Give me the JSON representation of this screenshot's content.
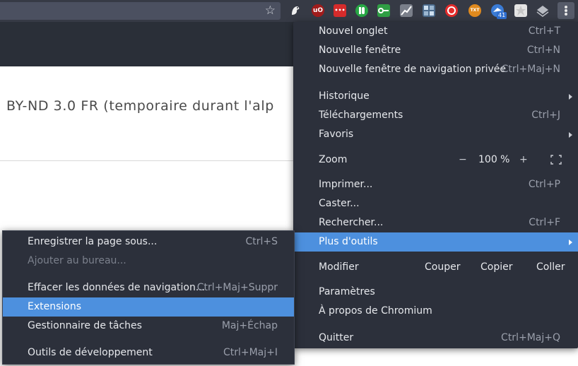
{
  "browser": {
    "extensions": [
      {
        "name": "pigeon-extension-icon",
        "text": "",
        "color": "#363a45"
      },
      {
        "name": "ublock-origin-icon",
        "text": "uO",
        "color": "#a01c1c"
      },
      {
        "name": "dots-extension-icon",
        "text": "•••",
        "color": "#d52b2b"
      },
      {
        "name": "toggle-extension-icon",
        "text": "",
        "color": "#28a745"
      },
      {
        "name": "key-extension-icon",
        "text": "",
        "color": "#2f9e44"
      },
      {
        "name": "chart-extension-icon",
        "text": "",
        "color": "#7a7f8a"
      },
      {
        "name": "grid-extension-icon",
        "text": "",
        "color": "#4c6b8c"
      },
      {
        "name": "creative-cloud-icon",
        "text": "",
        "color": "#e32b2b"
      },
      {
        "name": "text-extension-icon",
        "text": "",
        "color": "#e08a1e"
      },
      {
        "name": "bird-extension-icon",
        "text": "",
        "color": "#3a7bd5"
      },
      {
        "name": "puzzle-extension-icon",
        "text": "",
        "color": "#e4e4e4"
      },
      {
        "name": "layers-extension-icon",
        "text": "",
        "color": "#b9bcc3"
      }
    ],
    "badge": "41"
  },
  "page": {
    "license_text": "BY-ND 3.0 FR (temporaire durant l'alp"
  },
  "main_menu": {
    "new_tab": {
      "label": "Nouvel onglet",
      "shortcut": "Ctrl+T"
    },
    "new_window": {
      "label": "Nouvelle fenêtre",
      "shortcut": "Ctrl+N"
    },
    "new_private_window": {
      "label": "Nouvelle fenêtre de navigation privée",
      "shortcut": "Ctrl+Maj+N"
    },
    "history": {
      "label": "Historique"
    },
    "downloads": {
      "label": "Téléchargements",
      "shortcut": "Ctrl+J"
    },
    "bookmarks": {
      "label": "Favoris"
    },
    "zoom": {
      "label": "Zoom",
      "minus": "−",
      "value": "100 %",
      "plus": "+"
    },
    "print": {
      "label": "Imprimer...",
      "shortcut": "Ctrl+P"
    },
    "cast": {
      "label": "Caster..."
    },
    "find": {
      "label": "Rechercher...",
      "shortcut": "Ctrl+F"
    },
    "more_tools": {
      "label": "Plus d'outils"
    },
    "edit": {
      "label": "Modifier",
      "cut": "Couper",
      "copy": "Copier",
      "paste": "Coller"
    },
    "settings": {
      "label": "Paramètres"
    },
    "about": {
      "label": "À propos de Chromium"
    },
    "quit": {
      "label": "Quitter",
      "shortcut": "Ctrl+Maj+Q"
    }
  },
  "sub_menu": {
    "save_page": {
      "label": "Enregistrer la page sous...",
      "shortcut": "Ctrl+S"
    },
    "add_to_desktop": {
      "label": "Ajouter au bureau..."
    },
    "clear_data": {
      "label": "Effacer les données de navigation...",
      "shortcut": "Ctrl+Maj+Suppr"
    },
    "extensions": {
      "label": "Extensions"
    },
    "task_manager": {
      "label": "Gestionnaire de tâches",
      "shortcut": "Maj+Échap"
    },
    "dev_tools": {
      "label": "Outils de développement",
      "shortcut": "Ctrl+Maj+I"
    }
  },
  "colors": {
    "menu_bg": "#2c303b",
    "highlight": "#4d90de",
    "toolbar": "#363a45"
  }
}
